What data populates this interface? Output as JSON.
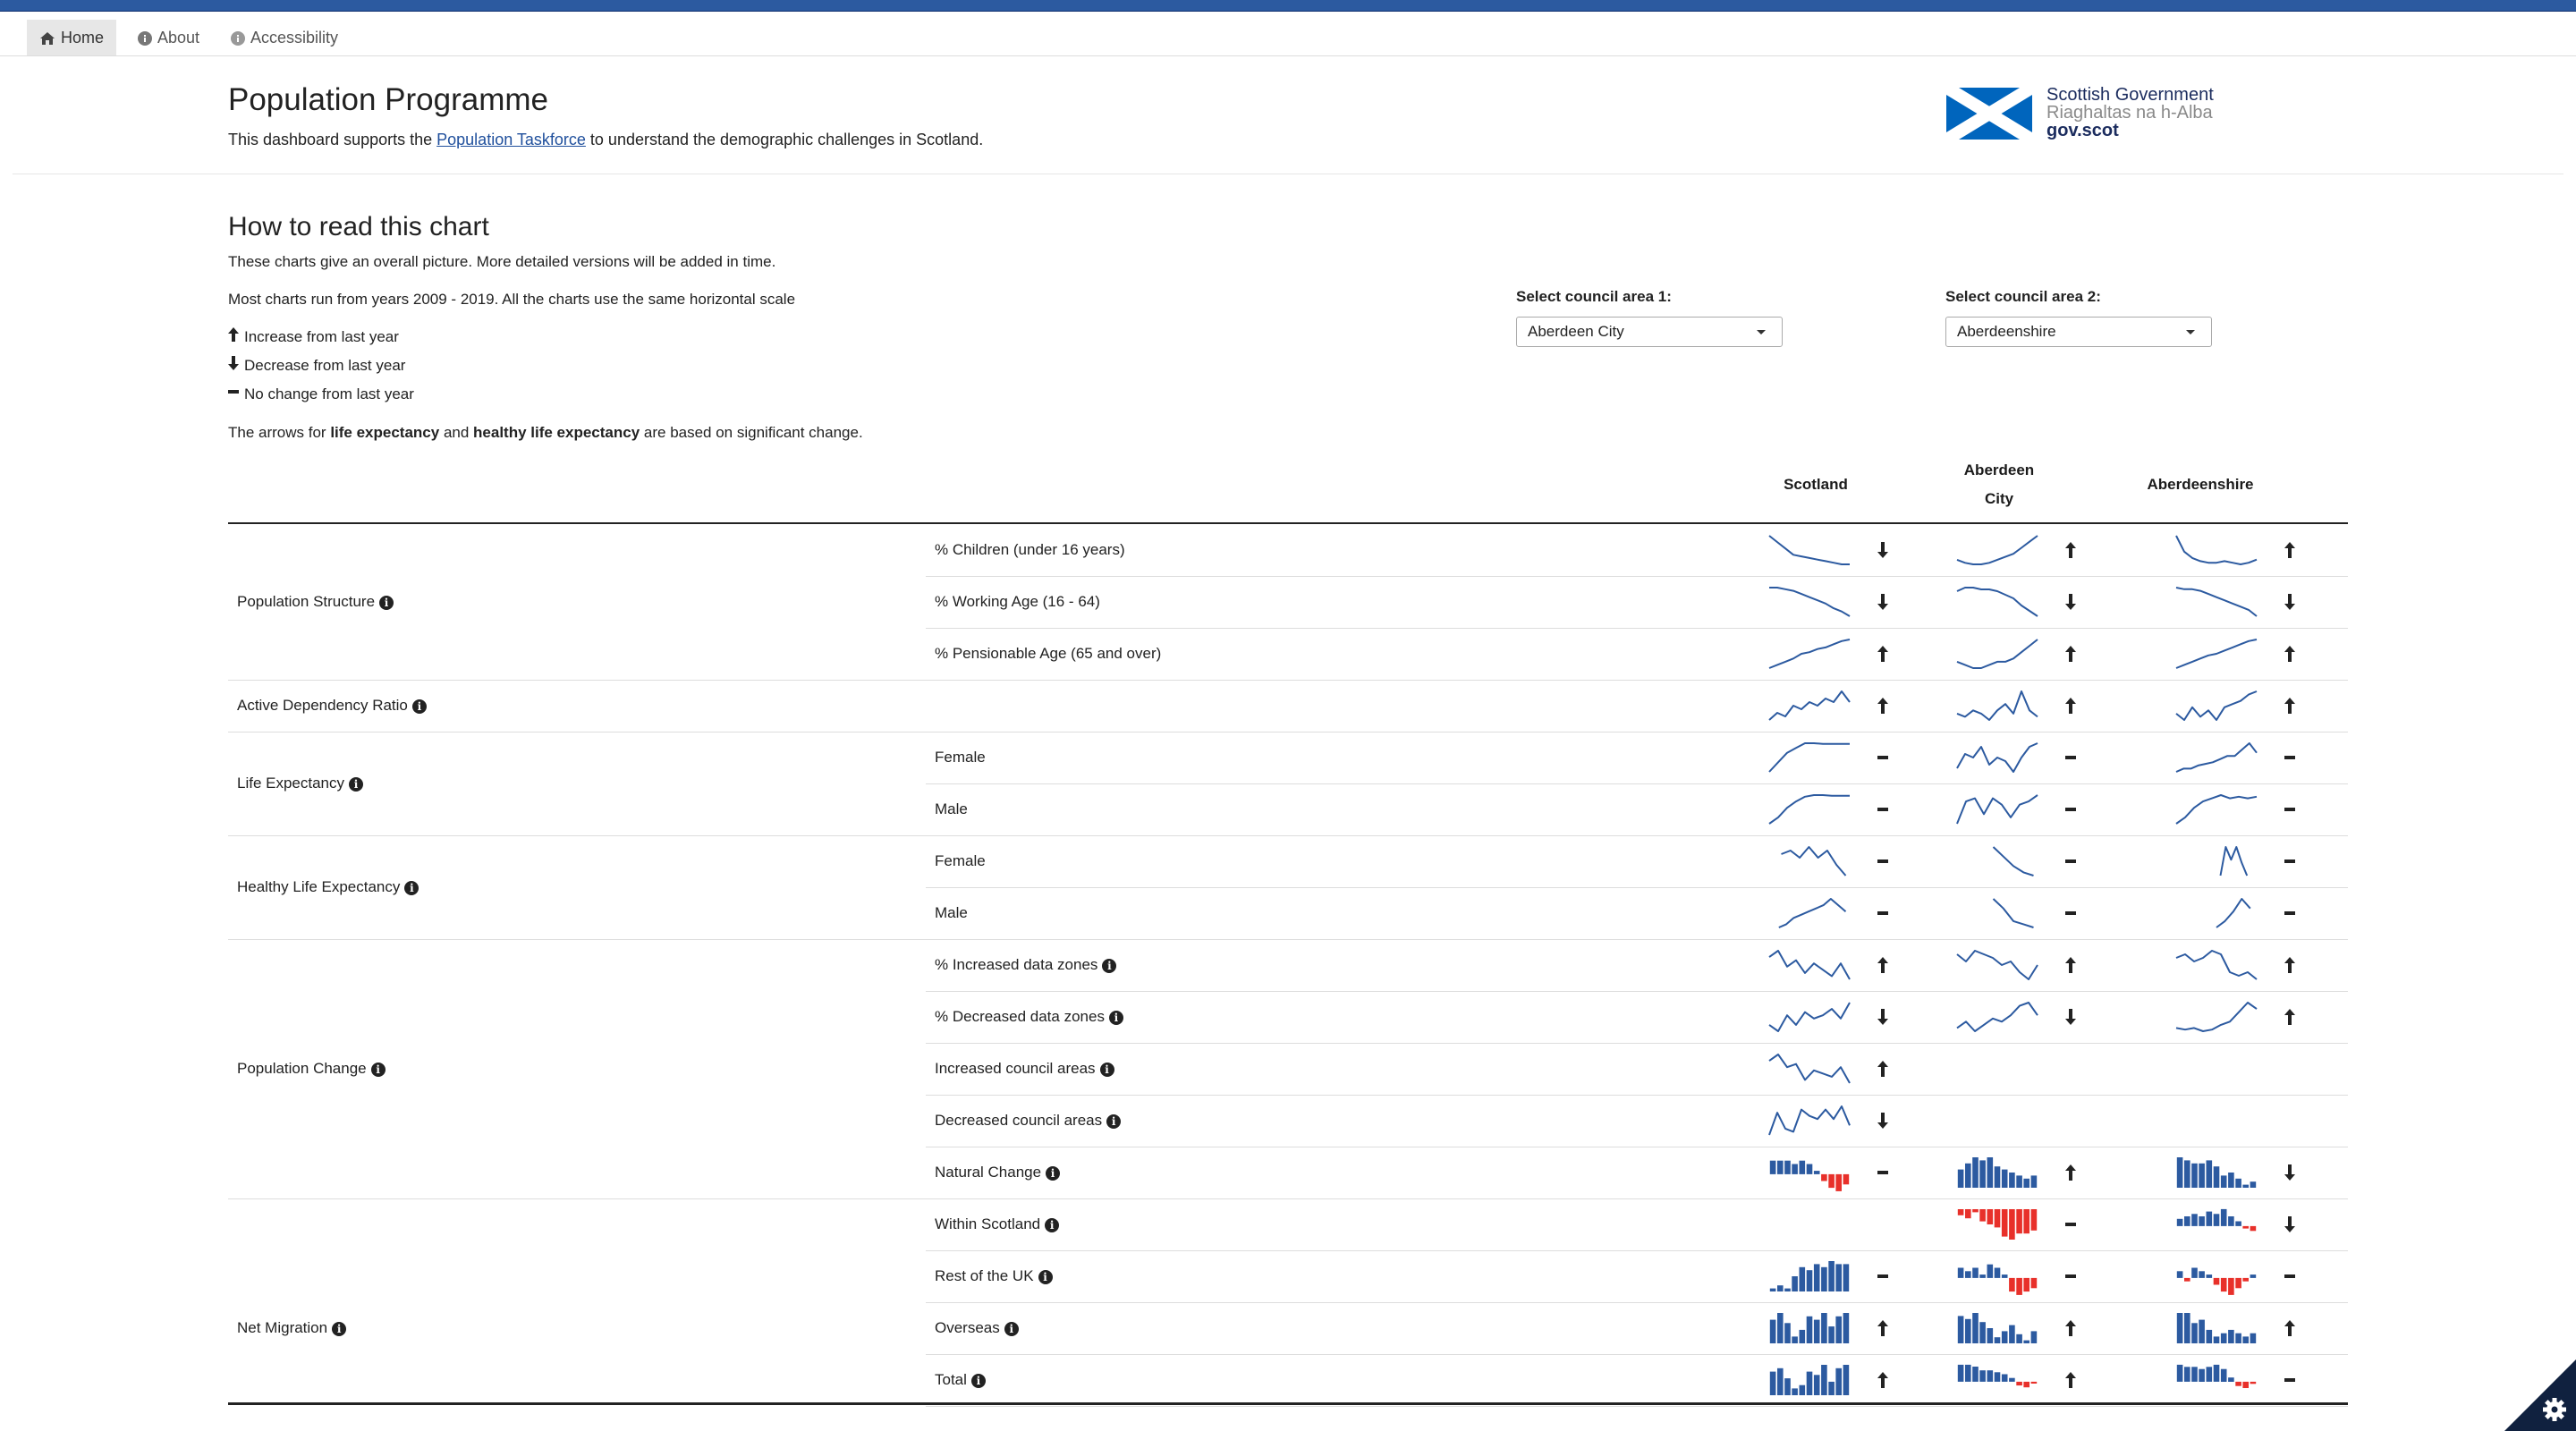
{
  "nav": {
    "items": [
      {
        "label": "Home",
        "icon": "home-icon",
        "active": true
      },
      {
        "label": "About",
        "icon": "info-circle-icon",
        "active": false
      },
      {
        "label": "Accessibility",
        "icon": "info-circle-icon",
        "active": false
      }
    ]
  },
  "header": {
    "title": "Population Programme",
    "subtitle_before": "This dashboard supports the ",
    "subtitle_link": "Population Taskforce",
    "subtitle_after": " to understand the demographic challenges in Scotland.",
    "logo": {
      "line1": "Scottish Government",
      "line2": "Riaghaltas na h-Alba",
      "line3": "gov.scot",
      "flag_color": "#0065bd"
    }
  },
  "guide": {
    "heading": "How to read this chart",
    "line1": "These charts give an overall picture. More detailed versions will be added in time.",
    "line2": "Most charts run from years 2009 - 2019. All the charts use the same horizontal scale",
    "legend_up": "Increase from last year",
    "legend_down": "Decrease from last year",
    "legend_flat": "No change from last year",
    "note_pre": "The arrows for ",
    "note_b1": "life expectancy",
    "note_mid": " and ",
    "note_b2": "healthy life expectancy",
    "note_post": " are based on significant change."
  },
  "selectors": {
    "area1_label": "Select council area 1:",
    "area1_value": "Aberdeen City",
    "area2_label": "Select council area 2:",
    "area2_value": "Aberdeenshire"
  },
  "columns": [
    "Scotland",
    "Aberdeen City",
    "Aberdeenshire"
  ],
  "colors": {
    "line": "#2c5aa0",
    "bar_pos": "#2c5aa0",
    "bar_neg": "#e8302a"
  },
  "categories": [
    {
      "label": "Population Structure",
      "info": true
    },
    {
      "label": "Active Dependency Ratio",
      "info": true
    },
    {
      "label": "Life Expectancy",
      "info": true
    },
    {
      "label": "Healthy Life Expectancy",
      "info": true
    },
    {
      "label": "Population Change",
      "info": true
    },
    {
      "label": "Net Migration",
      "info": true
    }
  ],
  "rows": [
    {
      "sub": "% Children (under 16 years)",
      "info": false,
      "type": "line",
      "cells": [
        {
          "values": [
            10,
            8,
            6,
            4,
            3.5,
            3,
            2.5,
            2,
            1.5,
            1,
            1
          ],
          "arrow": "down"
        },
        {
          "values": [
            2,
            1,
            0.5,
            0.5,
            1,
            2,
            3,
            4,
            6,
            8,
            10
          ],
          "arrow": "up"
        },
        {
          "values": [
            10,
            5,
            3,
            2,
            1.5,
            1.5,
            2,
            1.5,
            1,
            1.5,
            2.5
          ],
          "arrow": "up"
        }
      ]
    },
    {
      "sub": "% Working Age (16 - 64)",
      "info": false,
      "type": "line",
      "cells": [
        {
          "values": [
            10,
            10,
            9.5,
            9,
            8,
            7,
            6,
            5,
            3.5,
            2.5,
            1
          ],
          "arrow": "down"
        },
        {
          "values": [
            8,
            9,
            9,
            8.5,
            8.5,
            8,
            7,
            6,
            4,
            2.5,
            1
          ],
          "arrow": "down"
        },
        {
          "values": [
            10,
            9.5,
            9.5,
            9,
            8,
            7,
            6,
            5,
            4,
            3,
            1
          ],
          "arrow": "down"
        }
      ]
    },
    {
      "sub": "% Pensionable Age (65 and over)",
      "info": false,
      "type": "line",
      "cells": [
        {
          "values": [
            1,
            2,
            3,
            4,
            5.5,
            6,
            7,
            7.5,
            8.5,
            9.5,
            10
          ],
          "arrow": "up"
        },
        {
          "values": [
            3,
            2,
            1,
            1,
            2,
            3,
            3,
            4,
            6,
            8,
            10
          ],
          "arrow": "up"
        },
        {
          "values": [
            1,
            2,
            3,
            4,
            5,
            5.5,
            6.5,
            7.5,
            8.5,
            9.5,
            10
          ],
          "arrow": "up"
        }
      ]
    },
    {
      "sub": "",
      "info": false,
      "type": "line",
      "cells": [
        {
          "values": [
            2,
            4,
            3,
            6,
            5,
            7,
            6,
            8,
            7,
            10,
            7
          ],
          "arrow": "up"
        },
        {
          "values": [
            3,
            2,
            4,
            3,
            1,
            4,
            6,
            3,
            10,
            4,
            2
          ],
          "arrow": "up"
        },
        {
          "values": [
            3,
            1,
            5,
            2,
            4,
            1,
            5,
            6,
            7,
            9,
            10
          ],
          "arrow": "up"
        }
      ]
    },
    {
      "sub": "Female",
      "info": false,
      "type": "line",
      "cells": [
        {
          "values": [
            1,
            4,
            7,
            8.5,
            10,
            10,
            9.8,
            9.8,
            9.8,
            9.8
          ],
          "arrow": "flat"
        },
        {
          "values": [
            3,
            7,
            6,
            9,
            4,
            6,
            5,
            2,
            6,
            9,
            10
          ],
          "arrow": "flat"
        },
        {
          "values": [
            1,
            2,
            2,
            3,
            3.5,
            4,
            5,
            6,
            6,
            8,
            10,
            7
          ],
          "arrow": "flat"
        }
      ]
    },
    {
      "sub": "Male",
      "info": false,
      "type": "line",
      "cells": [
        {
          "values": [
            1,
            3,
            6,
            8,
            9.5,
            10,
            10,
            9.8,
            9.8,
            9.8
          ],
          "arrow": "flat"
        },
        {
          "values": [
            1,
            8,
            9,
            4,
            9,
            7,
            3,
            7,
            8,
            10
          ],
          "arrow": "flat"
        },
        {
          "values": [
            1,
            3,
            6,
            8,
            9,
            10,
            9,
            9.5,
            9,
            9.5
          ],
          "arrow": "flat"
        }
      ]
    },
    {
      "sub": "Female",
      "info": false,
      "type": "line",
      "cells": [
        {
          "values": [
            8,
            9,
            7,
            10,
            7,
            9,
            5,
            2
          ],
          "arrow": "flat",
          "xs": 0.15,
          "xe": 0.95
        },
        {
          "values": [
            10,
            7,
            4,
            2,
            1
          ],
          "arrow": "flat",
          "xs": 0.45,
          "xe": 0.95
        },
        {
          "values": [
            1,
            10,
            6,
            10,
            5,
            1
          ],
          "arrow": "flat",
          "xs": 0.55,
          "xe": 0.88
        }
      ]
    },
    {
      "sub": "Male",
      "info": false,
      "type": "line",
      "cells": [
        {
          "values": [
            1,
            2,
            4,
            5,
            6,
            7,
            8,
            10,
            8,
            6
          ],
          "arrow": "flat",
          "xs": 0.12,
          "xe": 0.95
        },
        {
          "values": [
            10,
            7,
            3,
            2,
            1
          ],
          "arrow": "flat",
          "xs": 0.45,
          "xe": 0.95
        },
        {
          "values": [
            1,
            3,
            6,
            10,
            7
          ],
          "arrow": "flat",
          "xs": 0.5,
          "xe": 0.92
        }
      ]
    },
    {
      "sub": "% Increased data zones",
      "info": true,
      "type": "line",
      "cells": [
        {
          "values": [
            8,
            10,
            5,
            7,
            3,
            6,
            4,
            2,
            6,
            1
          ],
          "arrow": "up"
        },
        {
          "values": [
            8,
            6,
            9,
            8,
            7,
            5,
            6,
            3,
            1,
            5
          ],
          "arrow": "up"
        },
        {
          "values": [
            7,
            8,
            6,
            7,
            9,
            8,
            3,
            2,
            3,
            1
          ],
          "arrow": "up"
        }
      ]
    },
    {
      "sub": "% Decreased data zones",
      "info": true,
      "type": "line",
      "cells": [
        {
          "values": [
            3,
            1,
            6,
            3,
            7,
            5,
            6,
            8,
            5,
            10
          ],
          "arrow": "down"
        },
        {
          "values": [
            2,
            4,
            1,
            3,
            5,
            4,
            6,
            9,
            10,
            6
          ],
          "arrow": "down"
        },
        {
          "values": [
            2,
            1.5,
            2,
            1,
            1.5,
            3,
            4,
            7,
            10,
            8
          ],
          "arrow": "up"
        }
      ]
    },
    {
      "sub": "Increased council areas",
      "info": true,
      "type": "line",
      "cells": [
        {
          "values": [
            8,
            10,
            6,
            7,
            2,
            5,
            4,
            3,
            6,
            1
          ],
          "arrow": "up"
        },
        null,
        null
      ]
    },
    {
      "sub": "Decreased council areas",
      "info": true,
      "type": "line",
      "cells": [
        {
          "values": [
            1,
            8,
            3,
            2,
            9,
            7,
            6,
            9,
            6,
            10,
            4
          ],
          "arrow": "down"
        },
        null,
        null
      ]
    },
    {
      "sub": "Natural Change",
      "info": true,
      "type": "bar",
      "cells": [
        {
          "values": [
            4,
            4,
            4,
            3,
            4,
            3,
            1,
            -2,
            -4,
            -5,
            -3
          ],
          "arrow": "flat"
        },
        {
          "values": [
            6,
            8,
            10,
            9,
            10,
            7,
            6,
            5,
            4,
            3,
            4
          ],
          "arrow": "up"
        },
        {
          "values": [
            10,
            9,
            8,
            8,
            9,
            7,
            4,
            5,
            3,
            1,
            2
          ],
          "arrow": "down"
        }
      ]
    },
    {
      "sub": "Within Scotland",
      "info": true,
      "type": "bar",
      "cells": [
        null,
        {
          "values": [
            -2,
            -3,
            -1,
            -4,
            -5,
            -6,
            -9,
            -10,
            -8,
            -8,
            -7
          ],
          "arrow": "flat"
        },
        {
          "values": [
            3,
            4,
            5,
            4,
            6,
            5,
            7,
            4,
            2,
            -1,
            -2
          ],
          "arrow": "down"
        }
      ]
    },
    {
      "sub": "Rest of the UK",
      "info": true,
      "type": "bar",
      "cells": [
        {
          "values": [
            1,
            2,
            1,
            5,
            8,
            7,
            9,
            8,
            10,
            9,
            9
          ],
          "arrow": "flat"
        },
        {
          "values": [
            3,
            2,
            3,
            1,
            4,
            3,
            1,
            -4,
            -5,
            -4,
            -3
          ],
          "arrow": "flat"
        },
        {
          "values": [
            2,
            -1,
            3,
            2,
            1,
            -2,
            -4,
            -5,
            -3,
            -1,
            1
          ],
          "arrow": "flat"
        }
      ]
    },
    {
      "sub": "Overseas",
      "info": true,
      "type": "bar",
      "cells": [
        {
          "values": [
            7,
            9,
            6,
            2,
            4,
            8,
            7,
            9,
            5,
            8,
            9
          ],
          "arrow": "up"
        },
        {
          "values": [
            9,
            8,
            10,
            7,
            5,
            2,
            4,
            6,
            3,
            1,
            4
          ],
          "arrow": "up"
        },
        {
          "values": [
            9,
            9,
            6,
            7,
            4,
            2,
            3,
            4,
            3,
            2,
            3
          ],
          "arrow": "up"
        }
      ]
    },
    {
      "sub": "Total",
      "info": true,
      "type": "bar",
      "cells": [
        {
          "values": [
            7,
            8,
            5,
            2,
            3,
            7,
            6,
            9,
            4,
            8,
            9
          ],
          "arrow": "up"
        },
        {
          "values": [
            9,
            9,
            8,
            6,
            6,
            5,
            4,
            2,
            -2,
            -3,
            -1
          ],
          "arrow": "up"
        },
        {
          "values": [
            8,
            7,
            7,
            6,
            7,
            8,
            6,
            2,
            -2,
            -3,
            -1
          ],
          "arrow": "flat"
        }
      ]
    }
  ]
}
